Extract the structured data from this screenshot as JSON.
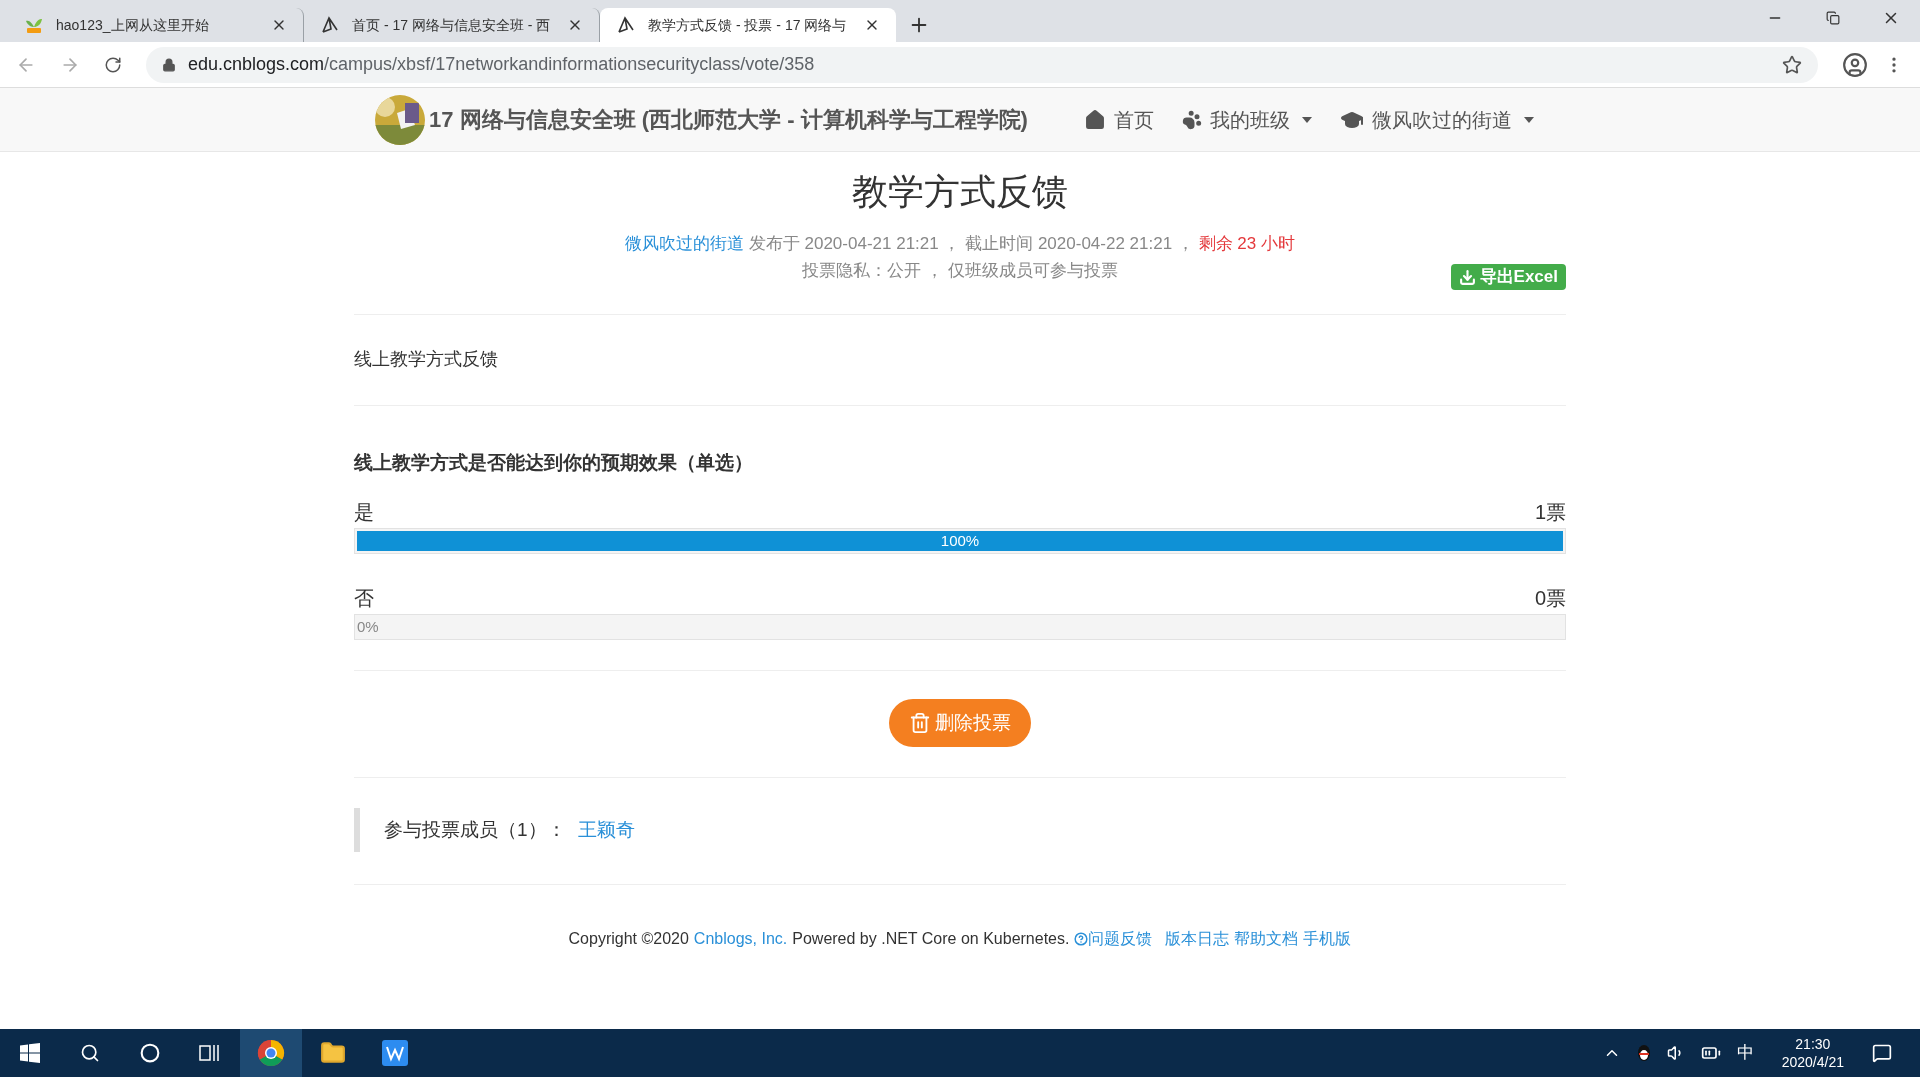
{
  "tabs": [
    {
      "kind": "hao",
      "title": "hao123_上网从这里开始",
      "selected": false
    },
    {
      "kind": "cnblogs",
      "title": "首页 - 17 网络与信息安全班 - 西",
      "selected": false
    },
    {
      "kind": "cnblogs",
      "title": "教学方式反馈 - 投票 - 17 网络与",
      "selected": true
    }
  ],
  "address": {
    "host": "edu.cnblogs.com",
    "path": "/campus/xbsf/17networkandinformationsecurityclass/vote/358"
  },
  "header": {
    "site_title": "17 网络与信息安全班 (西北师范大学 - 计算机科学与工程学院)",
    "nav": [
      {
        "kind": "home",
        "label": "首页",
        "has_menu": false
      },
      {
        "kind": "paw",
        "label": "我的班级",
        "has_menu": true
      },
      {
        "kind": "cap",
        "label": "微风吹过的街道",
        "has_menu": true
      }
    ]
  },
  "vote": {
    "title": "教学方式反馈",
    "author": "微风吹过的街道",
    "meta": "发布于 2020-04-21 21:21 ， 截止时间 2020-04-22 21:21 ，",
    "remaining": "剩余 23 小时",
    "privacy": "投票隐私：公开 ， 仅班级成员可参与投票",
    "export_button": "导出Excel",
    "description": "线上教学方式反馈",
    "question": "线上教学方式是否能达到你的预期效果（单选）",
    "options": [
      {
        "label": "是",
        "votes": "1票",
        "level": 1,
        "percent": "100%"
      },
      {
        "label": "否",
        "votes": "0票",
        "level": 0,
        "percent": "0%"
      }
    ],
    "delete_button": "删除投票",
    "members_label": "参与投票成员（1）：",
    "members": [
      "王颖奇"
    ]
  },
  "footer": {
    "copyright": "Copyright ©2020",
    "company": "Cnblogs, Inc.",
    "powered": "Powered by .NET Core on Kubernetes.",
    "links": [
      {
        "kind": "help",
        "label": "问题反馈"
      },
      {
        "kind": "plain",
        "label": "版本日志"
      },
      {
        "kind": "plain",
        "label": "帮助文档"
      },
      {
        "kind": "plain",
        "label": "手机版"
      }
    ]
  },
  "taskbar": {
    "ime": "中",
    "time": "21:30",
    "date": "2020/4/21"
  }
}
